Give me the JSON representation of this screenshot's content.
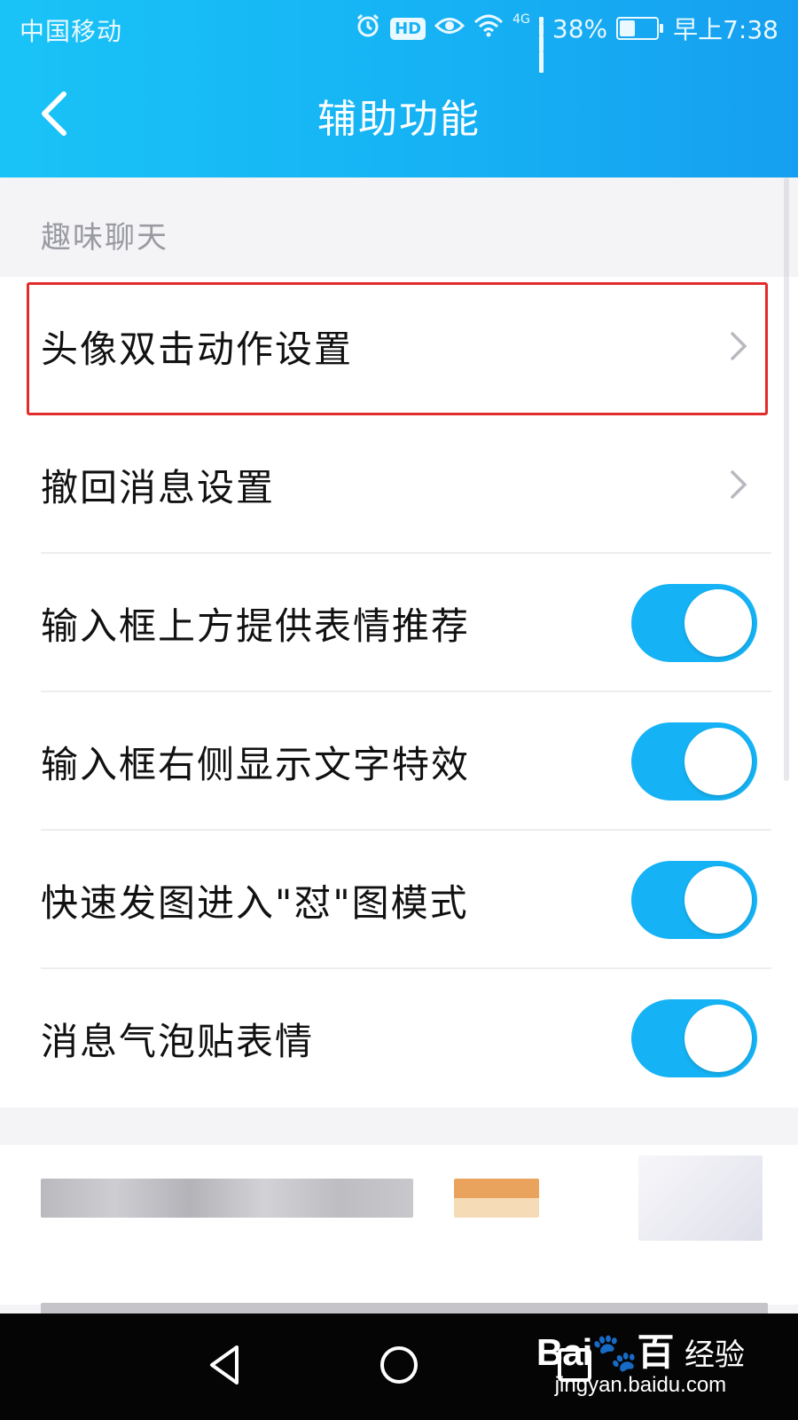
{
  "status_bar": {
    "carrier": "中国移动",
    "network": "4G",
    "battery": "38%",
    "time": "早上7:38",
    "hd_badge": "HD",
    "icons": [
      "alarm-icon",
      "eye-icon",
      "wifi-icon",
      "signal-icon",
      "battery-icon"
    ]
  },
  "header": {
    "title": "辅助功能",
    "back_icon": "chevron-left-icon"
  },
  "section": {
    "label": "趣味聊天"
  },
  "items": [
    {
      "label": "头像双击动作设置",
      "control": "chevron",
      "highlighted": true
    },
    {
      "label": "撤回消息设置",
      "control": "chevron"
    },
    {
      "label": "输入框上方提供表情推荐",
      "control": "toggle",
      "on": true
    },
    {
      "label": "输入框右侧显示文字特效",
      "control": "toggle",
      "on": true
    },
    {
      "label": "快速发图进入\"怼\"图模式",
      "control": "toggle",
      "on": true
    },
    {
      "label": "消息气泡贴表情",
      "control": "toggle",
      "on": true
    }
  ],
  "nav_bar": {
    "buttons": [
      "back-triangle-icon",
      "home-circle-icon",
      "recents-square-icon"
    ]
  },
  "watermark": {
    "logo_left": "Bai",
    "logo_right": "百",
    "text": "经验",
    "url": "jingyan.baidu.com"
  },
  "colors": {
    "header": "#16b2f4",
    "toggle_on": "#15b3f5",
    "highlight_border": "#e22b2b",
    "section_label": "#9a9aa3"
  }
}
